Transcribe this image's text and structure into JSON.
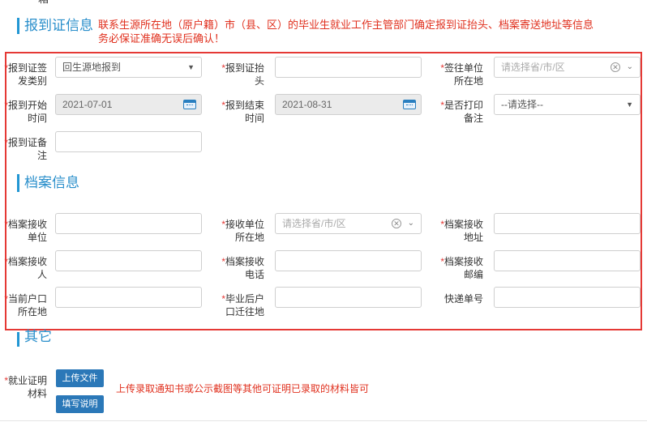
{
  "top_cut_text": "箱",
  "report_section": {
    "title": "报到证信息",
    "note_line1": "联系生源所在地（原户籍）市（县、区）的毕业生就业工作主管部门确定报到证抬头、档案寄送地址等信息",
    "note_line2": "务必保证准确无误后确认！"
  },
  "labels": {
    "report_type_1": "报到证签",
    "report_type_2": "发类别",
    "report_header_1": "报到证抬",
    "report_header_2": "头",
    "sign_unit_1": "签往单位",
    "sign_unit_2": "所在地",
    "start_time_1": "报到开始",
    "start_time_2": "时间",
    "end_time_1": "报到结束",
    "end_time_2": "时间",
    "print_note_1": "是否打印",
    "print_note_2": "备注",
    "report_remark_1": "报到证备",
    "report_remark_2": "注",
    "archive_unit_1": "档案接收",
    "archive_unit_2": "单位",
    "recv_location_1": "接收单位",
    "recv_location_2": "所在地",
    "archive_addr_1": "档案接收",
    "archive_addr_2": "地址",
    "archive_person_1": "档案接收",
    "archive_person_2": "人",
    "archive_phone_1": "档案接收",
    "archive_phone_2": "电话",
    "archive_zip_1": "档案接收",
    "archive_zip_2": "邮编",
    "hukou_now_1": "当前户口",
    "hukou_now_2": "所在地",
    "hukou_after_1": "毕业后户",
    "hukou_after_2": "口迁往地",
    "express_no": "快递单号",
    "employment_proof_1": "就业证明",
    "employment_proof_2": "材料"
  },
  "fields": {
    "report_type_value": "回生源地报到",
    "sign_unit_placeholder": "请选择省/市/区",
    "start_date": "2021-07-01",
    "end_date": "2021-08-31",
    "print_note_value": "--请选择--",
    "recv_location_placeholder": "请选择省/市/区"
  },
  "archive_section": {
    "title": "档案信息"
  },
  "other_section": {
    "title": "其它"
  },
  "upload": {
    "upload_button": "上传文件",
    "fill_button": "填写说明",
    "hint": "上传录取通知书或公示截图等其他可证明已录取的材料皆可"
  },
  "icons": {
    "select_arrow": "▼",
    "chevron": "⌄",
    "clear": "✕"
  }
}
